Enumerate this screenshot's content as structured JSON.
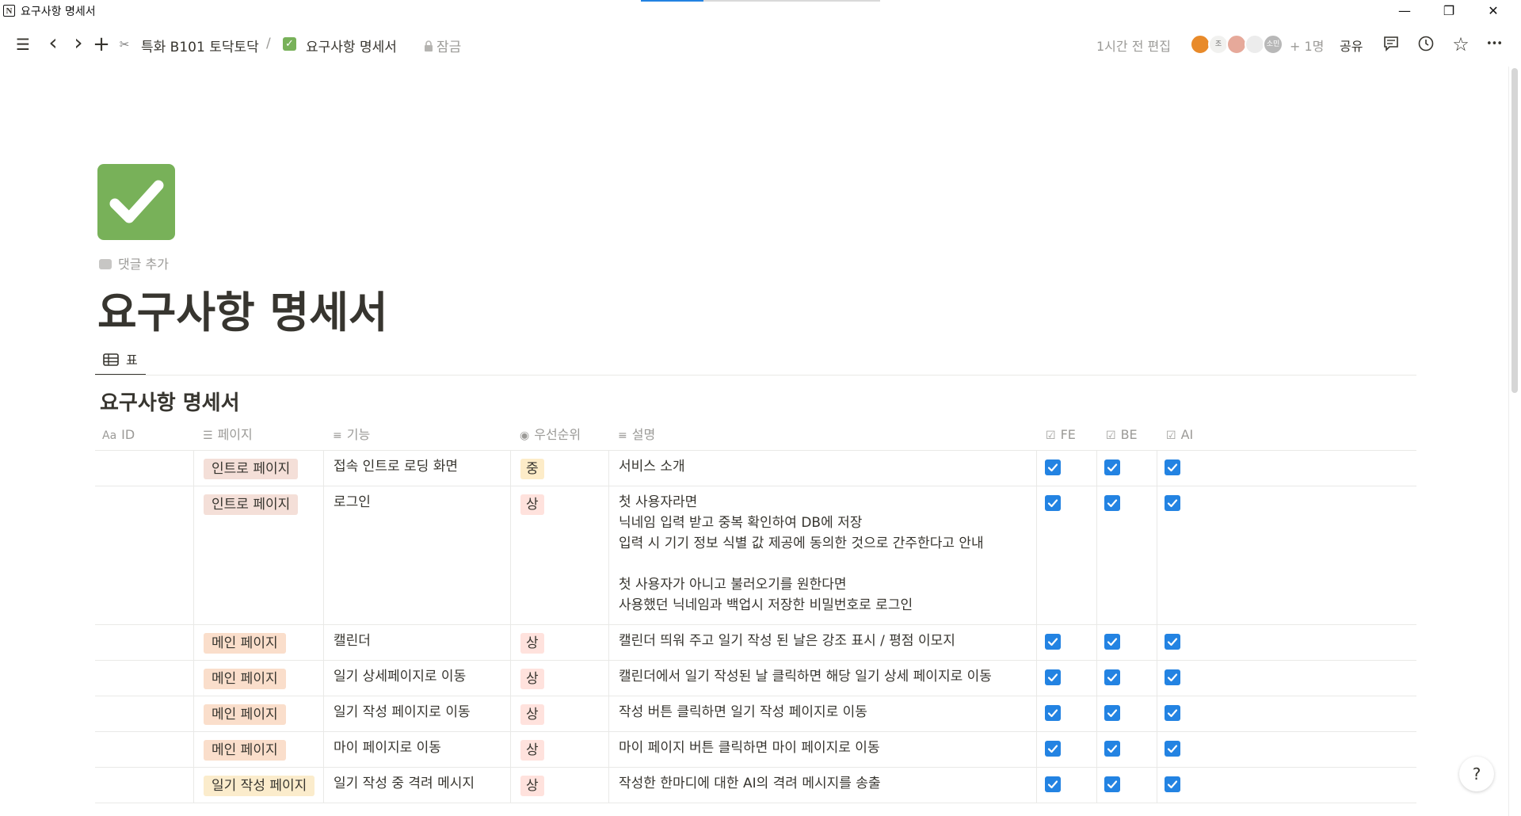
{
  "window": {
    "app_logo": "N",
    "title": "요구사항 명세서",
    "loading_progress": 0.26,
    "controls": {
      "minimize": "—",
      "maximize": "❐",
      "close": "✕"
    }
  },
  "topbar": {
    "icons": {
      "menu": "☰",
      "back": "‹",
      "forward": "›",
      "new": "+"
    },
    "workspace_icon": "✂",
    "breadcrumb_parent": "특화 B101 토닥토닥",
    "separator": "/",
    "breadcrumb_page_icon": "✓",
    "breadcrumb_page": "요구사항 명세서",
    "lock_label": "잠금",
    "edited": "1시간 전 편집",
    "avatars": [
      {
        "label": "",
        "color": "#e88a2a"
      },
      {
        "label": "조",
        "color": "#f1f1ef"
      },
      {
        "label": "",
        "color": "#e6a99a"
      },
      {
        "label": "",
        "color": "#ececec"
      },
      {
        "label": "소민",
        "color": "#b8b8b8"
      }
    ],
    "extra_users": "+ 1명",
    "share_label": "공유",
    "action_icons": {
      "comments": "☷",
      "history": "◷",
      "favorite": "☆",
      "more": "•••"
    }
  },
  "page": {
    "add_comment_label": "댓글 추가",
    "title": "요구사항 명세서",
    "view_tab_icon": "▦",
    "view_tab_label": "표",
    "database_title": "요구사항 명세서"
  },
  "table": {
    "columns": [
      {
        "icon": "Aa",
        "label": "ID"
      },
      {
        "icon": "☰",
        "label": "페이지"
      },
      {
        "icon": "≡",
        "label": "기능"
      },
      {
        "icon": "◉",
        "label": "우선순위"
      },
      {
        "icon": "≡",
        "label": "설명"
      },
      {
        "icon": "☑",
        "label": "FE"
      },
      {
        "icon": "☑",
        "label": "BE"
      },
      {
        "icon": "☑",
        "label": "AI"
      }
    ],
    "colors": {
      "page_intro": "#f4dfd8",
      "page_main": "#fadecb",
      "page_diary": "#fbeccc",
      "priority_mid": "#fdecc8",
      "priority_high": "#ffe2dd",
      "checkbox": "#2383e2"
    },
    "rows": [
      {
        "id": "",
        "page": "인트로 페이지",
        "page_type": "intro",
        "feature": "접속 인트로 로딩 화면",
        "priority": "중",
        "priority_type": "mid",
        "description": "서비스 소개",
        "fe": true,
        "be": true,
        "ai": true
      },
      {
        "id": "",
        "page": "인트로 페이지",
        "page_type": "intro",
        "feature": "로그인",
        "priority": "상",
        "priority_type": "high",
        "description": "첫 사용자라면\n닉네임 입력 받고 중복 확인하여 DB에 저장\n입력 시 기기 정보 식별 값 제공에 동의한 것으로 간주한다고 안내\n\n첫 사용자가 아니고 불러오기를 원한다면\n사용했던 닉네임과 백업시 저장한 비밀번호로 로그인",
        "fe": true,
        "be": true,
        "ai": true
      },
      {
        "id": "",
        "page": "메인 페이지",
        "page_type": "main",
        "feature": "캘린더",
        "priority": "상",
        "priority_type": "high",
        "description": "캘린더 띄워 주고 일기 작성 된 날은 강조 표시 / 평점 이모지",
        "fe": true,
        "be": true,
        "ai": true
      },
      {
        "id": "",
        "page": "메인 페이지",
        "page_type": "main",
        "feature": "일기 상세페이지로 이동",
        "priority": "상",
        "priority_type": "high",
        "description": "캘린더에서 일기 작성된 날 클릭하면 해당 일기 상세 페이지로 이동",
        "fe": true,
        "be": true,
        "ai": true
      },
      {
        "id": "",
        "page": "메인 페이지",
        "page_type": "main",
        "feature": "일기 작성 페이지로 이동",
        "priority": "상",
        "priority_type": "high",
        "description": "작성 버튼 클릭하면 일기 작성 페이지로 이동",
        "fe": true,
        "be": true,
        "ai": true
      },
      {
        "id": "",
        "page": "메인 페이지",
        "page_type": "main",
        "feature": "마이 페이지로 이동",
        "priority": "상",
        "priority_type": "high",
        "description": "마이 페이지 버튼 클릭하면 마이 페이지로 이동",
        "fe": true,
        "be": true,
        "ai": true
      },
      {
        "id": "",
        "page": "일기 작성 페이지",
        "page_type": "diary",
        "feature": "일기 작성 중 격려 메시지",
        "priority": "상",
        "priority_type": "high",
        "description": "작성한 한마디에 대한 AI의 격려 메시지를 송출",
        "fe": true,
        "be": true,
        "ai": true
      }
    ]
  },
  "help_label": "?"
}
